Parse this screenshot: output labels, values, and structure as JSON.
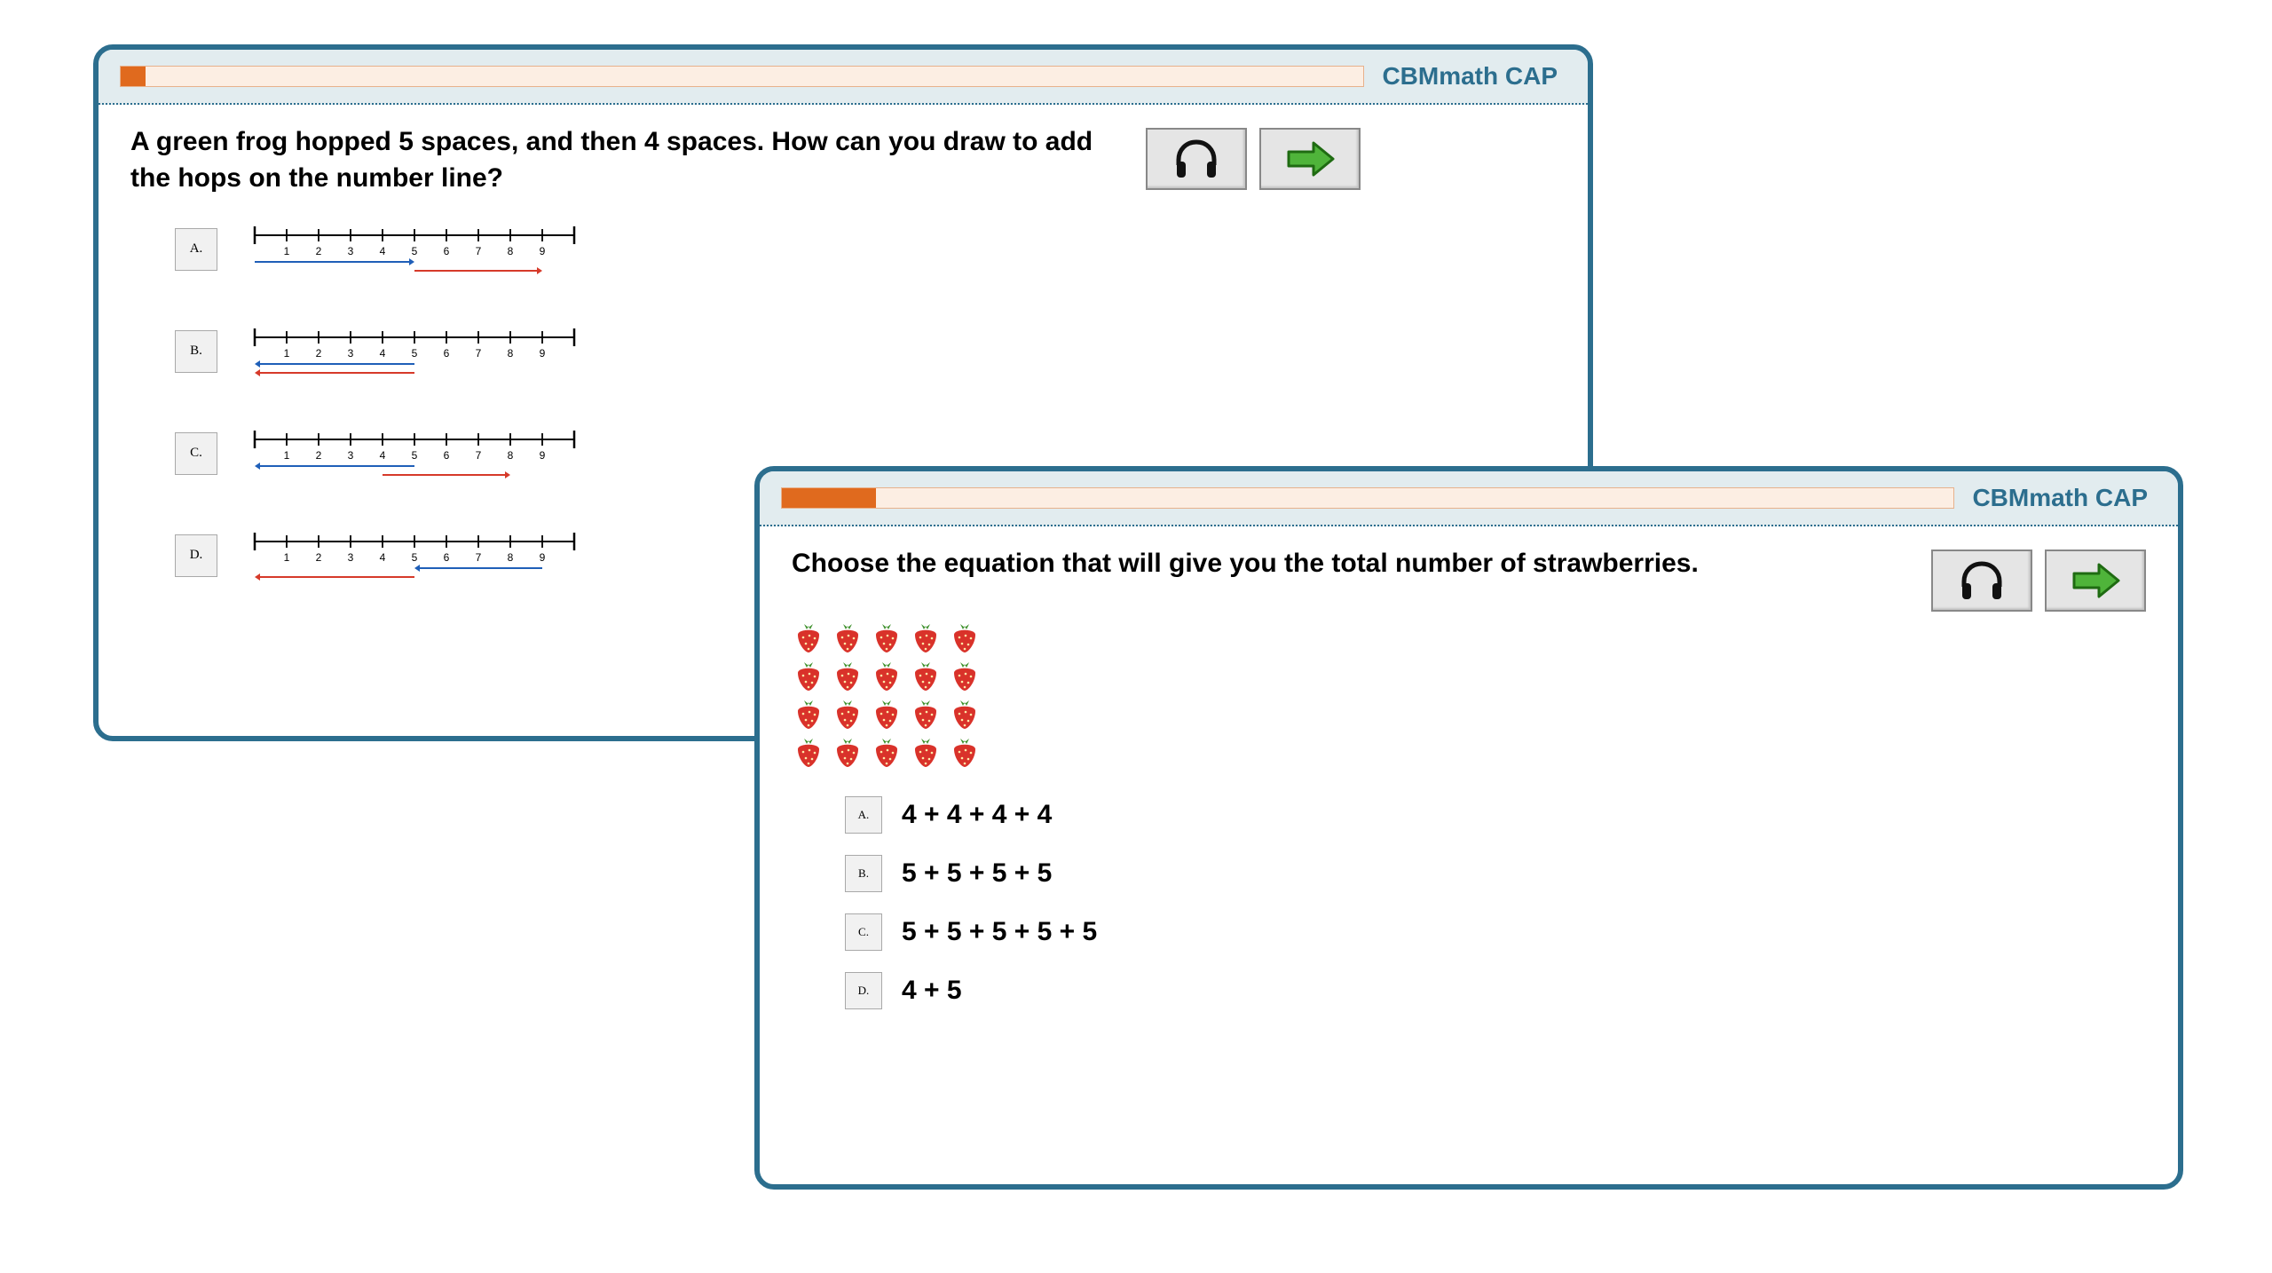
{
  "panel1": {
    "brand": "CBMmath CAP",
    "progress_percent": 2,
    "question": "A green frog hopped 5 spaces, and then 4 spaces. How can you draw to add the hops on the number line?",
    "numberline_labels": [
      "1",
      "2",
      "3",
      "4",
      "5",
      "6",
      "7",
      "8",
      "9"
    ],
    "choices": [
      {
        "label": "A.",
        "blue_from": 0,
        "blue_to": 5,
        "red_from": 5,
        "red_to": 9
      },
      {
        "label": "B.",
        "blue_from": 5,
        "blue_to": 0,
        "red_from": 5,
        "red_to": 0
      },
      {
        "label": "C.",
        "blue_from": 5,
        "blue_to": 0,
        "red_from": 4,
        "red_to": 8
      },
      {
        "label": "D.",
        "blue_from": 9,
        "blue_to": 5,
        "red_from": 5,
        "red_to": 0
      }
    ]
  },
  "panel2": {
    "brand": "CBMmath CAP",
    "progress_percent": 8,
    "question": "Choose the equation that will give you the total number of strawberries.",
    "grid_rows": 4,
    "grid_cols": 5,
    "choices": [
      {
        "label": "A.",
        "text": "4 + 4 + 4 + 4"
      },
      {
        "label": "B.",
        "text": "5 + 5 + 5 + 5"
      },
      {
        "label": "C.",
        "text": "5 + 5 + 5 + 5 + 5"
      },
      {
        "label": "D.",
        "text": "4 + 5"
      }
    ]
  }
}
